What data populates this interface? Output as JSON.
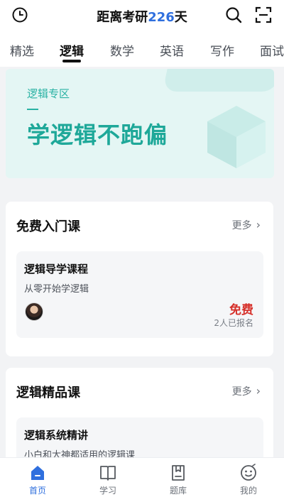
{
  "header": {
    "title_prefix": "距离考研",
    "days": "226",
    "title_suffix": "天"
  },
  "tabs": [
    {
      "label": "精选"
    },
    {
      "label": "逻辑"
    },
    {
      "label": "数学"
    },
    {
      "label": "英语"
    },
    {
      "label": "写作"
    },
    {
      "label": "面试"
    }
  ],
  "active_tab": "逻辑",
  "banner": {
    "subtitle": "逻辑专区",
    "headline": "学逻辑不跑偏"
  },
  "free_section": {
    "title": "免费入门课",
    "more": "更多",
    "course": {
      "title": "逻辑导学课程",
      "subtitle": "从零开始学逻辑",
      "price": "免费",
      "enrolled": "2人已报名"
    }
  },
  "premium_section": {
    "title": "逻辑精品课",
    "more": "更多",
    "course": {
      "title": "逻辑系统精讲",
      "subtitle": "小白和大神都适用的逻辑课"
    }
  },
  "bottom_nav": [
    {
      "label": "首页",
      "icon": "home-icon",
      "active": true
    },
    {
      "label": "学习",
      "icon": "book-icon",
      "active": false
    },
    {
      "label": "题库",
      "icon": "question-bank-icon",
      "active": false
    },
    {
      "label": "我的",
      "icon": "profile-icon",
      "active": false
    }
  ],
  "colors": {
    "accent": "#2f6fde",
    "banner_teal": "#1ea899",
    "price_red": "#d6312b"
  }
}
